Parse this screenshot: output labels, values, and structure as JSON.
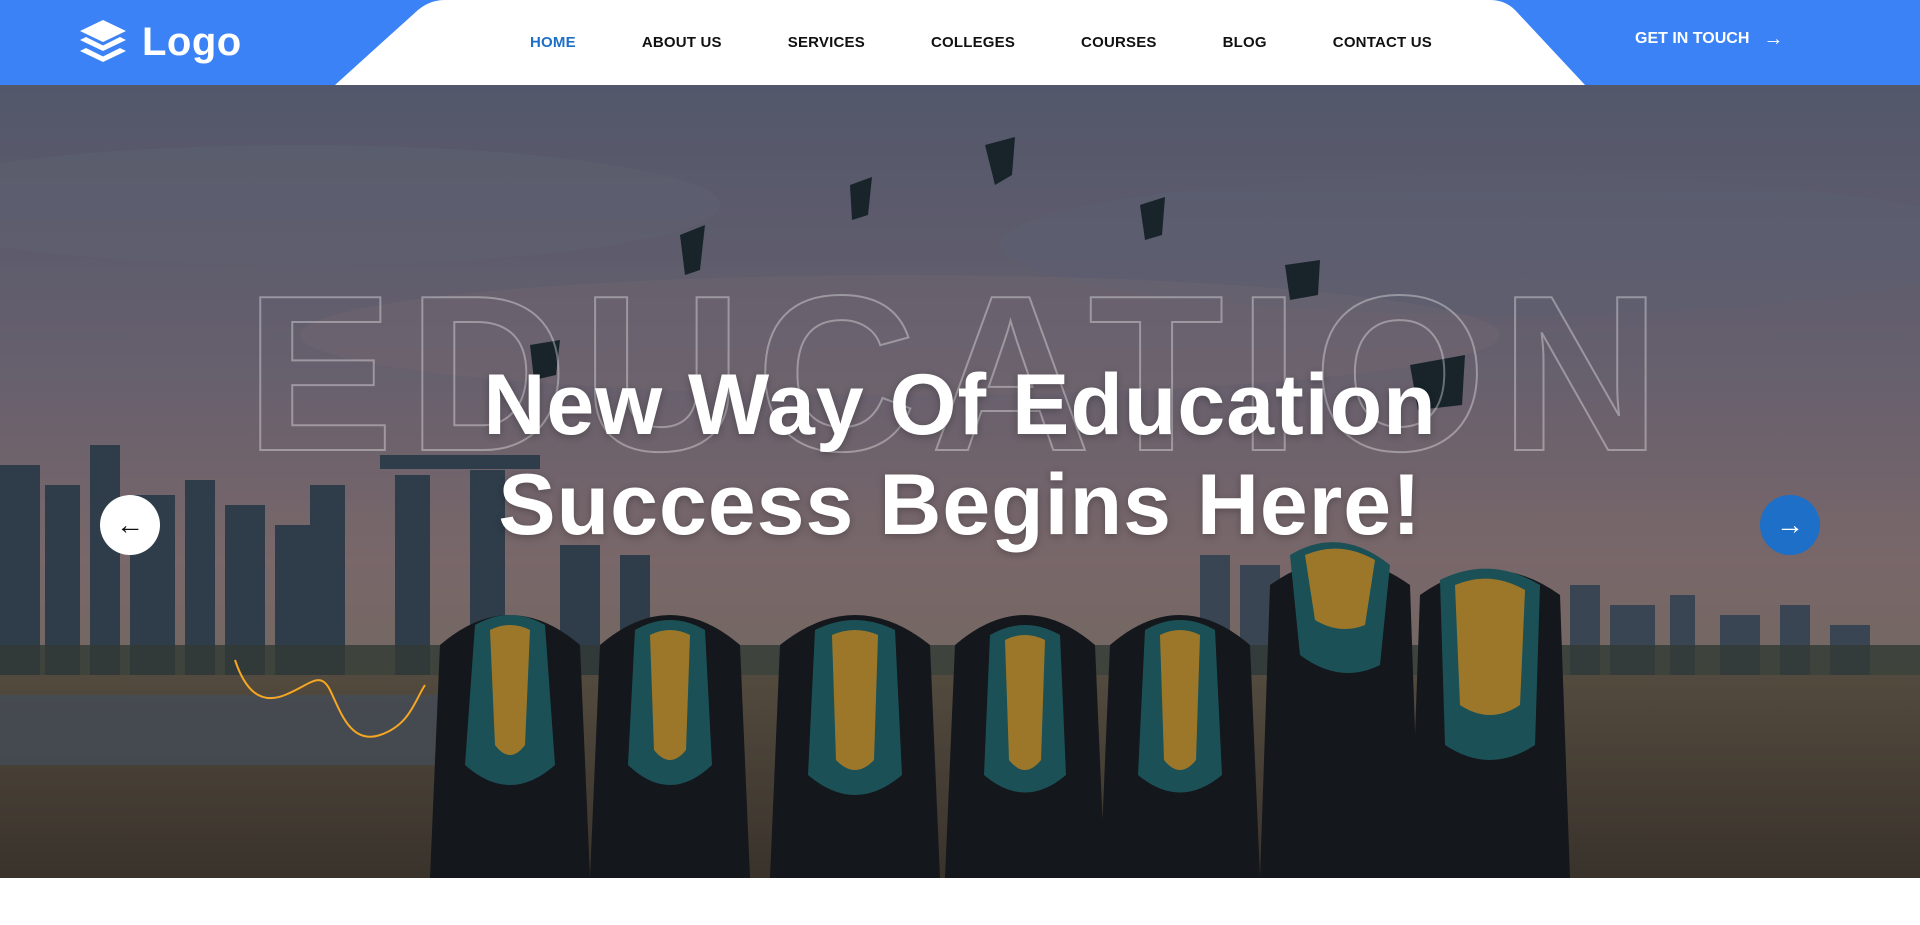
{
  "brand": {
    "logo_text": "Logo",
    "logo_icon": "stacked-layers-icon"
  },
  "nav": {
    "items": [
      {
        "label": "HOME",
        "active": true
      },
      {
        "label": "ABOUT US",
        "active": false
      },
      {
        "label": "SERVICES",
        "active": false
      },
      {
        "label": "COLLEGES",
        "active": false
      },
      {
        "label": "COURSES",
        "active": false
      },
      {
        "label": "BLOG",
        "active": false
      },
      {
        "label": "CONTACT US",
        "active": false
      }
    ],
    "cta_label": "GET IN TOUCH",
    "cta_icon": "arrow-right-icon"
  },
  "hero": {
    "outline_word": "EDUCATION",
    "title_line1": "New Way Of Education",
    "title_line2": "Success Begins Here!",
    "prev_icon": "arrow-left-icon",
    "next_icon": "arrow-right-icon",
    "prev_glyph": "←",
    "next_glyph": "→"
  },
  "colors": {
    "primary": "#3b82f6",
    "accent_active": "#1d6fc7",
    "nav_text": "#111111",
    "squiggle": "#f5a623",
    "white": "#ffffff"
  }
}
